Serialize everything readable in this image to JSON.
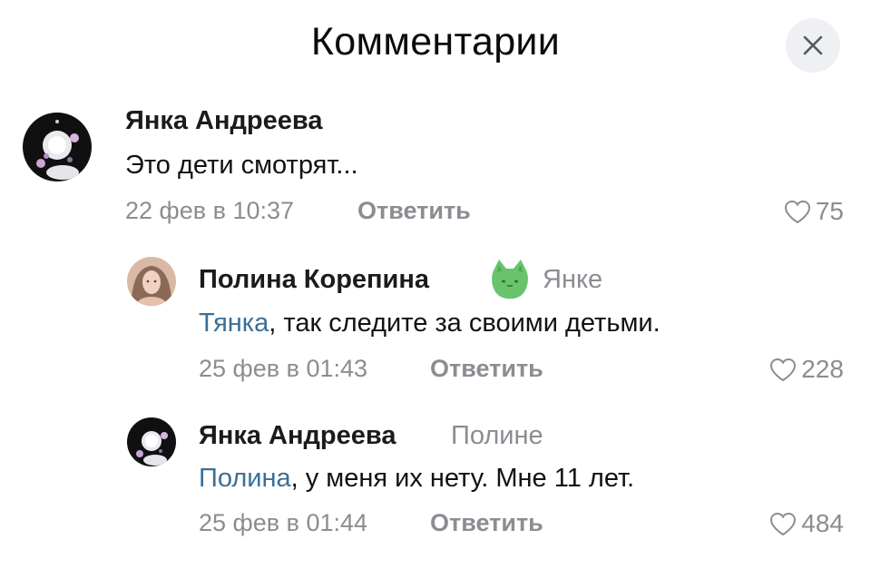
{
  "header": {
    "title": "Комментарии",
    "close_icon": "close-icon"
  },
  "comments": [
    {
      "author": "Янка Андреева",
      "text": "Это дети смотрят...",
      "date": "22 фев в 10:37",
      "reply_label": "Ответить",
      "likes": "75"
    },
    {
      "author": "Полина Корепина",
      "badge_icon": "green-cat-sticker-icon",
      "reply_to": "Янке",
      "mention": "Тянка",
      "text_rest": ", так следите за своими детьми.",
      "date": "25 фев в 01:43",
      "reply_label": "Ответить",
      "likes": "228"
    },
    {
      "author": "Янка Андреева",
      "reply_to": "Полине",
      "mention": "Полина",
      "text_rest": ", у меня их нету. Мне 11 лет.",
      "date": "25 фев в 01:44",
      "reply_label": "Ответить",
      "likes": "484"
    }
  ],
  "colors": {
    "muted": "#8a8d91",
    "mention": "#3b6f97",
    "close_bg": "#eef0f3"
  }
}
